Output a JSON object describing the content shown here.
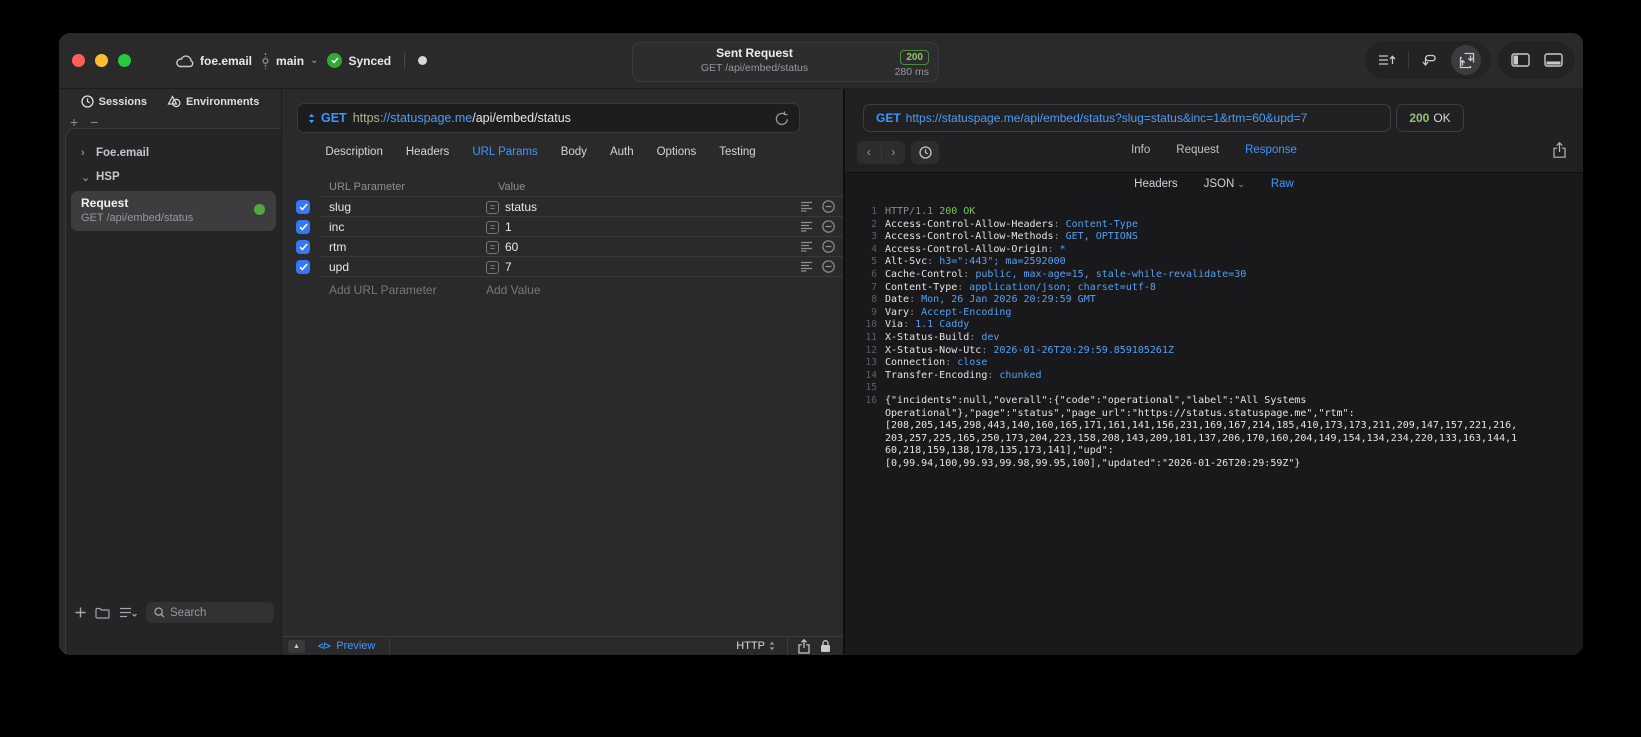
{
  "colors": {
    "accent_blue": "#3f96ff",
    "code_value_blue": "#55a0f2",
    "success_green": "#7cc158",
    "checkbox_blue": "#3478f6",
    "request_dot_green": "#55a643",
    "traffic_red": "#ff5f57",
    "traffic_yellow": "#febc2e",
    "traffic_green": "#28c840"
  },
  "icons": {
    "equals": "=",
    "chevron_down": "⌄",
    "chevron_right": "›",
    "back": "‹",
    "forward": "›",
    "collapse_up": "▲",
    "plus": "+",
    "minus": "−"
  },
  "titlebar": {
    "project": "foe.email",
    "branch": "main",
    "sync_label": "Synced",
    "summary": {
      "title": "Sent Request",
      "subtitle": "GET /api/embed/status",
      "status": "200",
      "duration": "280 ms"
    }
  },
  "sidebar": {
    "tab_sessions": "Sessions",
    "tab_environments": "Environments",
    "group_1": "Foe.email",
    "group_2": "HSP",
    "request_title": "Request",
    "request_subtitle": "GET /api/embed/status",
    "search_placeholder": "Search"
  },
  "request": {
    "method": "GET",
    "url_scheme": "https",
    "url_host": "://statuspage.me",
    "url_path": "/api/embed/status",
    "tabs": [
      "Description",
      "Headers",
      "URL Params",
      "Body",
      "Auth",
      "Options",
      "Testing"
    ],
    "active_tab": "URL Params",
    "params": {
      "col_name": "URL Parameter",
      "col_value": "Value",
      "rows": [
        {
          "name": "slug",
          "value": "status"
        },
        {
          "name": "inc",
          "value": "1"
        },
        {
          "name": "rtm",
          "value": "60"
        },
        {
          "name": "upd",
          "value": "7"
        }
      ],
      "add_name": "Add URL Parameter",
      "add_value": "Add Value"
    },
    "footer": {
      "preview": "Preview",
      "protocol": "HTTP"
    }
  },
  "response": {
    "method": "GET",
    "url": "https://statuspage.me/api/embed/status?slug=status&inc=1&rtm=60&upd=7",
    "status_code": "200",
    "status_text": "OK",
    "tabs": [
      "Info",
      "Request",
      "Response"
    ],
    "active_tab": "Response",
    "subtabs": [
      "Headers",
      "JSON",
      "Raw"
    ],
    "active_subtab": "Raw",
    "lines": [
      {
        "num": "1",
        "gray": "HTTP/1.1 ",
        "green": "200 OK"
      },
      {
        "num": "2",
        "key": "Access-Control-Allow-Headers",
        "sep": ": ",
        "val": "Content-Type"
      },
      {
        "num": "3",
        "key": "Access-Control-Allow-Methods",
        "sep": ": ",
        "val": "GET, OPTIONS"
      },
      {
        "num": "4",
        "key": "Access-Control-Allow-Origin",
        "sep": ": ",
        "val": "*"
      },
      {
        "num": "5",
        "key": "Alt-Svc",
        "sep": ": ",
        "val": "h3=\":443\"; ma=2592000"
      },
      {
        "num": "6",
        "key": "Cache-Control",
        "sep": ": ",
        "val": "public, max-age=15, stale-while-revalidate=30"
      },
      {
        "num": "7",
        "key": "Content-Type",
        "sep": ": ",
        "val": "application/json; charset=utf-8"
      },
      {
        "num": "8",
        "key": "Date",
        "sep": ": ",
        "val": "Mon, 26 Jan 2026 20:29:59 GMT"
      },
      {
        "num": "9",
        "key": "Vary",
        "sep": ": ",
        "val": "Accept-Encoding"
      },
      {
        "num": "10",
        "key": "Via",
        "sep": ": ",
        "val": "1.1 Caddy"
      },
      {
        "num": "11",
        "key": "X-Status-Build",
        "sep": ": ",
        "val": "dev"
      },
      {
        "num": "12",
        "key": "X-Status-Now-Utc",
        "sep": ": ",
        "val": "2026-01-26T20:29:59.859105261Z"
      },
      {
        "num": "13",
        "key": "Connection",
        "sep": ": ",
        "val": "close"
      },
      {
        "num": "14",
        "key": "Transfer-Encoding",
        "sep": ": ",
        "val": "chunked"
      },
      {
        "num": "15"
      },
      {
        "num": "16",
        "body": "{\"incidents\":null,\"overall\":{\"code\":\"operational\",\"label\":\"All Systems"
      },
      {
        "body": "Operational\"},\"page\":\"status\",\"page_url\":\"https://status.statuspage.me\",\"rtm\":"
      },
      {
        "body": "[208,205,145,298,443,140,160,165,171,161,141,156,231,169,167,214,185,410,173,173,211,209,147,157,221,216,"
      },
      {
        "body": "203,257,225,165,250,173,204,223,158,208,143,209,181,137,206,170,160,204,149,154,134,234,220,133,163,144,1"
      },
      {
        "body": "60,218,159,138,178,135,173,141],\"upd\":"
      },
      {
        "body": "[0,99.94,100,99.93,99.98,99.95,100],\"updated\":\"2026-01-26T20:29:59Z\"}"
      }
    ]
  }
}
